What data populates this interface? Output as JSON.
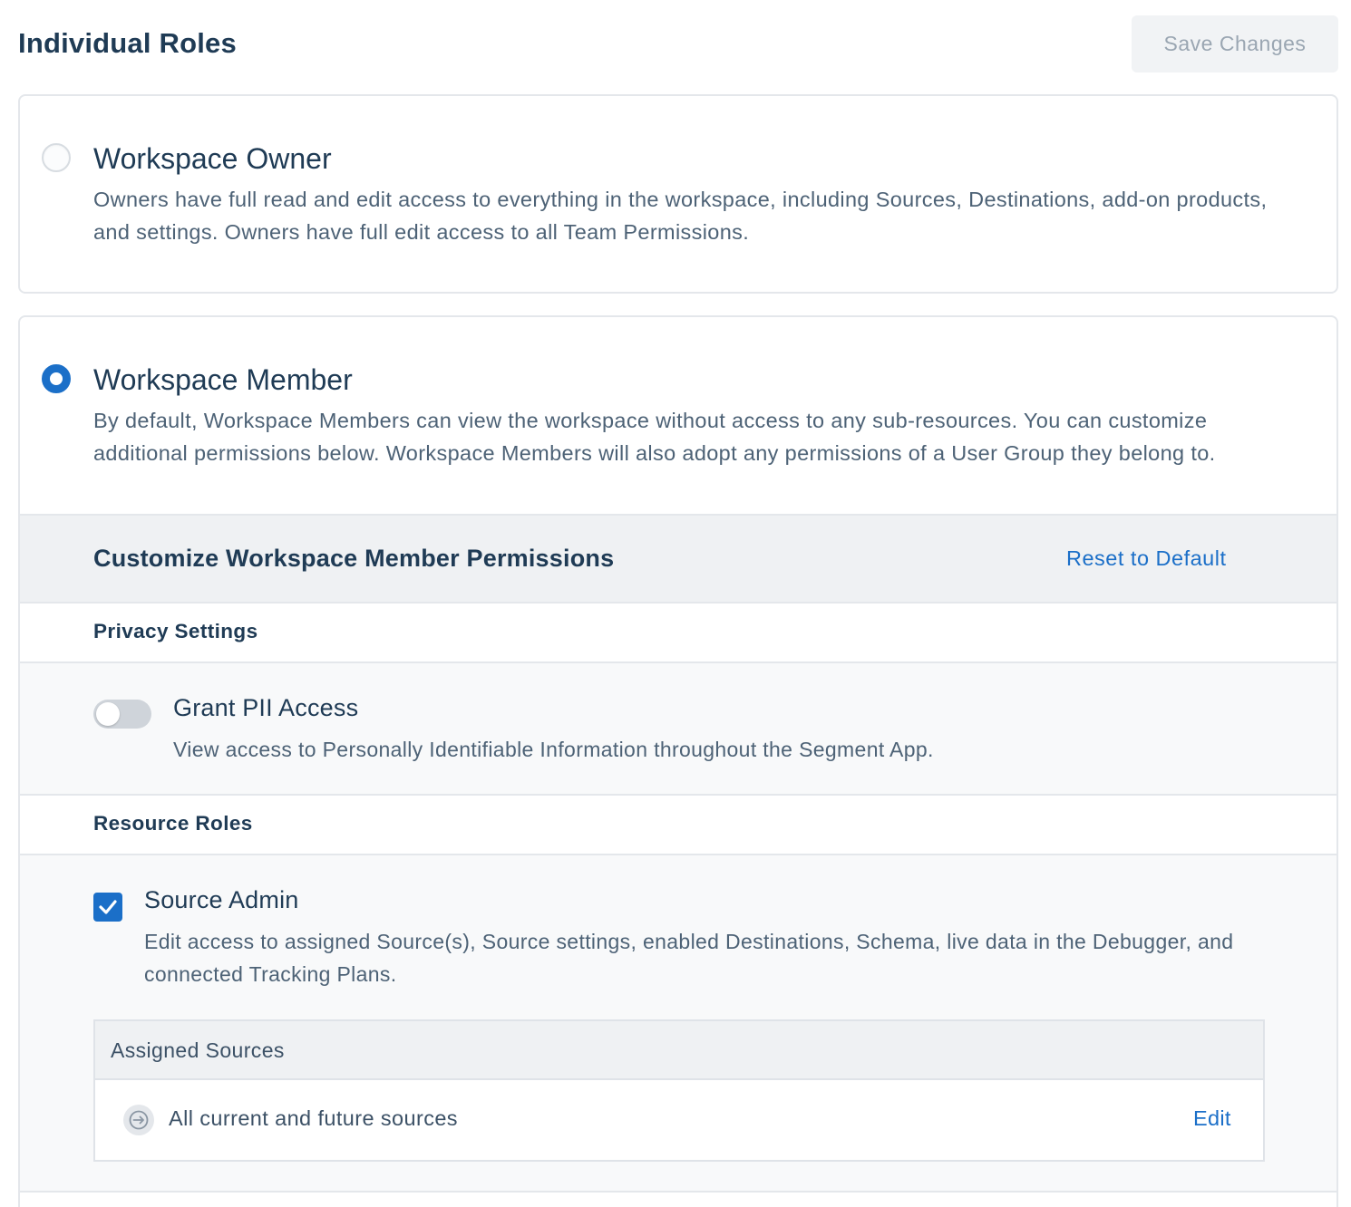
{
  "header": {
    "title": "Individual Roles",
    "save_label": "Save Changes"
  },
  "roles": {
    "owner": {
      "title": "Workspace Owner",
      "description": "Owners have full read and edit access to everything in the workspace, including Sources, Destinations, add-on products, and settings. Owners have full edit access to all Team Permissions.",
      "selected": false
    },
    "member": {
      "title": "Workspace Member",
      "description": "By default, Workspace Members can view the workspace without access to any sub-resources. You can customize additional permissions below. Workspace Members will also adopt any permissions of a User Group they belong to.",
      "selected": true
    }
  },
  "customize": {
    "title": "Customize Workspace Member Permissions",
    "reset_label": "Reset to Default"
  },
  "privacy": {
    "section_label": "Privacy Settings",
    "pii": {
      "title": "Grant PII Access",
      "description": "View access to Personally Identifiable Information throughout the Segment App.",
      "enabled": false
    }
  },
  "resource_roles": {
    "section_label": "Resource Roles",
    "source_admin": {
      "title": "Source Admin",
      "description": "Edit access to assigned Source(s), Source settings, enabled Destinations, Schema, live data in the Debugger, and connected Tracking Plans.",
      "checked": true,
      "assigned": {
        "header": "Assigned Sources",
        "row_text": "All current and future sources",
        "row_icon": "all-sources-icon",
        "edit_label": "Edit"
      }
    }
  },
  "colors": {
    "accent": "#1b6fc8",
    "text": "#1f3b55",
    "muted": "#4d6276",
    "panel": "#f8f9fa",
    "bar": "#eff1f3"
  }
}
